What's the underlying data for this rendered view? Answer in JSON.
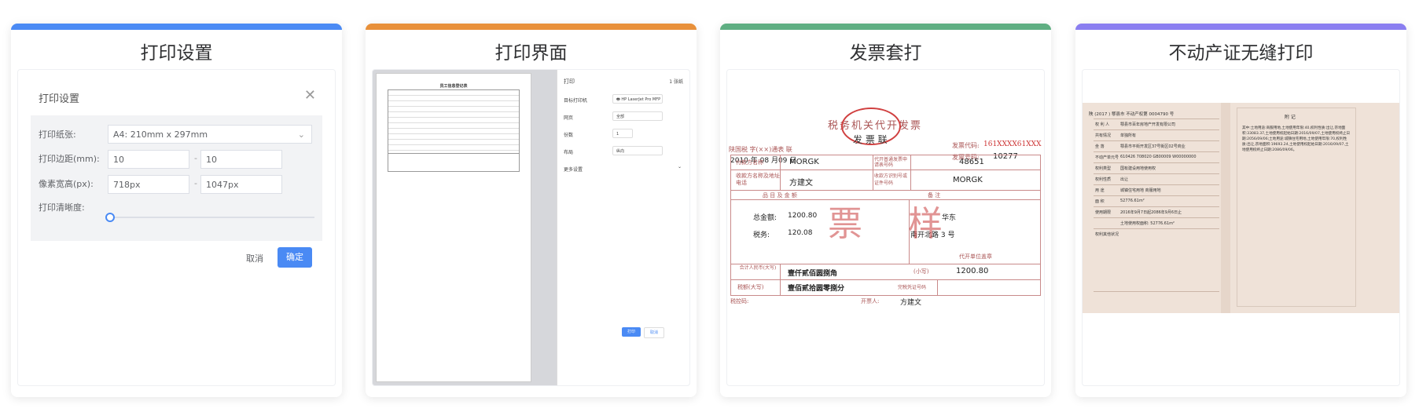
{
  "cards": [
    {
      "title": "打印设置",
      "color": "#4a8af4"
    },
    {
      "title": "打印界面",
      "color": "#e8903a"
    },
    {
      "title": "发票套打",
      "color": "#5fae82"
    },
    {
      "title": "不动产证无缝打印",
      "color": "#8a7ef0"
    }
  ],
  "settings": {
    "dialog_title": "打印设置",
    "paper_label": "打印纸张:",
    "paper_value": "A4: 210mm x 297mm",
    "margin_label": "打印边距(mm):",
    "margin_a": "10",
    "margin_b": "10",
    "pixel_label": "像素宽高(px):",
    "pixel_w": "718px",
    "pixel_h": "1047px",
    "clarity_label": "打印清晰度:",
    "dash": "-",
    "cancel": "取消",
    "confirm": "确定"
  },
  "print_ui": {
    "doc_title": "员工信息登记表",
    "panel_title": "打印",
    "pages": "1 张纸",
    "printer_label": "目标打印机",
    "printer_value": "HP LaserJet Pro MFP",
    "pages_label": "网页",
    "pages_value": "全部",
    "copies_label": "份数",
    "copies_value": "1",
    "layout_label": "布局",
    "layout_value": "纵向",
    "more": "更多设置",
    "print_btn": "打印",
    "cancel_btn": "取消"
  },
  "invoice": {
    "header_title": "税务机关代开发票",
    "stamp_text": "发 票 联",
    "left_header": "陕国税  字(××)通表  联",
    "date": "2010 年 08 月09 日",
    "code_label": "发票代码:",
    "code_value": "161XXXX61XXX",
    "number_label": "发票号码:",
    "number_value": "10277",
    "payer_label": "付款方名称",
    "payer_value": "MORGK",
    "agent_label": "代开普通发票申请表号码",
    "agent_value": "48651",
    "payee_label": "收款方名称及地址电话",
    "payee_value": "方建文",
    "payee_id_label": "收款方识别号或证件号码",
    "payee_id_value": "MORGK",
    "items_header": "品    目    及    金    额",
    "remarks_header": "备    注",
    "total_label": "总金额:",
    "total_value": "1200.80",
    "tax_label": "税务:",
    "tax_value": "120.08",
    "region": "华东",
    "address": "南开北路 3 号",
    "agent_note": "代开单位盖章",
    "watermark": "票 样",
    "sum_label": "合计人民币(大写)",
    "sum_value": "壹仟贰佰圆捌角",
    "sum_small_label": "(小写)",
    "sum_small_value": "1200.80",
    "taxamt_label": "税额(大写)",
    "taxamt_value": "壹佰贰拾圆零捌分",
    "tax_voucher_label": "完税凭证号码",
    "check_label": "税控码:",
    "drawer_label": "开票人:",
    "drawer_value": "方建文"
  },
  "cert": {
    "header_left": "陕 (2017 )  鄠县市  不动产权第 0004790 号",
    "right_title": "附    记",
    "rows": [
      {
        "label": "权 利 人",
        "value": "鄠县市百年房地产开发有限公司"
      },
      {
        "label": "共有情况",
        "value": "单独所有"
      },
      {
        "label": "坐    落",
        "value": "鄠县市平街开发区37号街区02号商业"
      },
      {
        "label": "不动产单元号",
        "value": "610426 708020 GB00009 W00000000"
      },
      {
        "label": "权利类型",
        "value": "国有建设用地使用权"
      },
      {
        "label": "权利性质",
        "value": "出让"
      },
      {
        "label": "用    途",
        "value": "城镇住宅用地 商服用地"
      },
      {
        "label": "面    积",
        "value": "52776.61m²"
      },
      {
        "label": "使用期限",
        "value": "2016年9月7日起2086年9月6日止"
      },
      {
        "label": "",
        "value": "土地使用权面积: 52776.61m²"
      },
      {
        "label": "权利其他状况",
        "value": ""
      }
    ],
    "notes": "其中:土地用途:商服用地,土地使用年限:40,权利性质:出让,宗地面积:33083.37,土地使用权起始日期:2016/09/07,土地使用权终止日期:2056/09/06;土地用途:城镇住宅用地,土地使用年限:70,权利性质:出让,宗地面积:19693.24,土地使用权起始日期:2016/09/07,土地使用权终止日期:2086/09/06。"
  }
}
